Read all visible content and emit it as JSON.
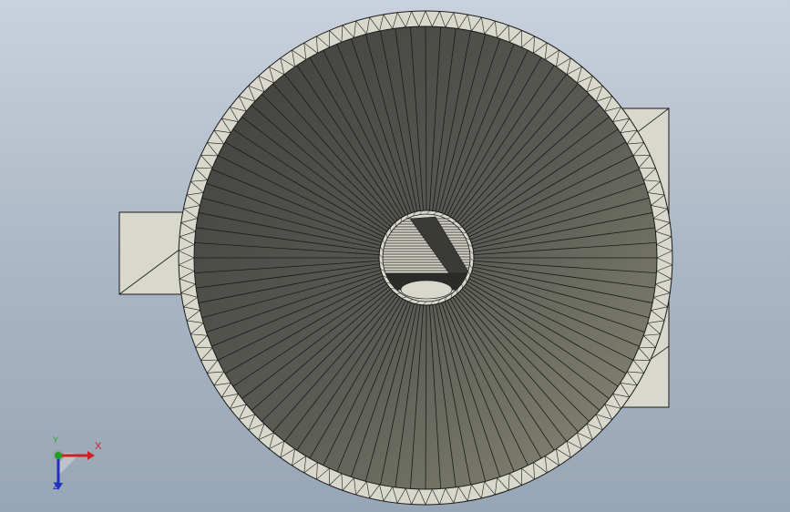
{
  "view": {
    "background_top": "#c9d1dc",
    "background_bottom": "#97a6b6",
    "part_fill": "#d9d8cc",
    "edge_color": "#1a1a1a",
    "cone_dark": "#4a4a46",
    "cone_light": "#8a8a78"
  },
  "triad": {
    "x_label": "X",
    "y_label": "Y",
    "z_label": "Z",
    "x_color": "#d02020",
    "y_color": "#20a020",
    "z_color": "#2030c0"
  }
}
